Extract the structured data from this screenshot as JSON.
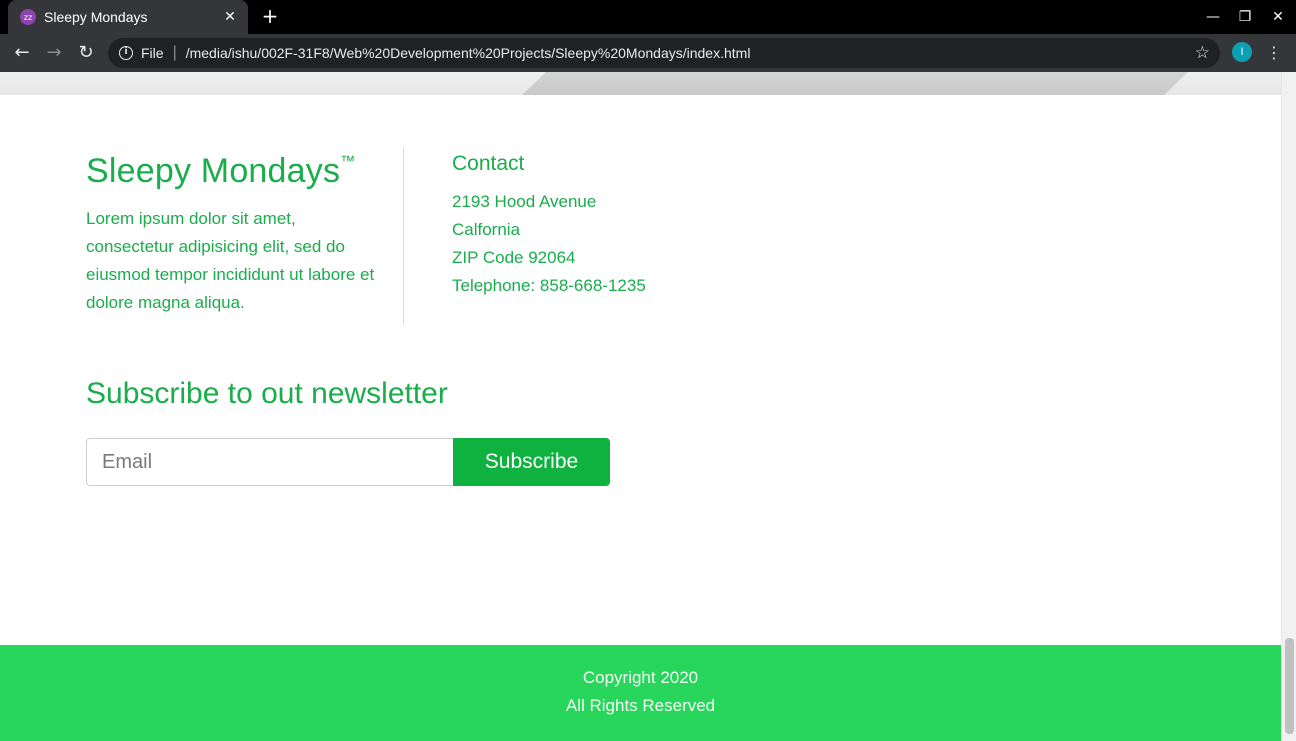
{
  "browser": {
    "tab": {
      "title": "Sleepy Mondays",
      "favicon": "zz",
      "close": "✕"
    },
    "new_tab": "+",
    "window_controls": {
      "minimize": "—",
      "maximize": "❐",
      "close": "✕"
    },
    "nav": {
      "back": "←",
      "forward": "→",
      "reload": "↻"
    },
    "address_bar": {
      "info_icon": "i",
      "scheme": "File",
      "separator": "|",
      "url": "/media/ishu/002F-31F8/Web%20Development%20Projects/Sleepy%20Mondays/index.html",
      "bookmark_icon": "☆"
    },
    "profile_initial": "I",
    "menu_icon": "⋮"
  },
  "footer_brand": {
    "title": "Sleepy Mondays",
    "trademark": "™",
    "description": "Lorem ipsum dolor sit amet, consectetur adipisicing elit, sed do eiusmod tempor incididunt ut labore et dolore magna aliqua."
  },
  "contact": {
    "title": "Contact",
    "lines": [
      "2193 Hood Avenue",
      "Calfornia",
      "ZIP Code 92064",
      "Telephone: 858-668-1235"
    ]
  },
  "newsletter": {
    "title": "Subscribe to out newsletter",
    "email_placeholder": "Email",
    "email_value": "",
    "button_label": "Subscribe"
  },
  "copyright": {
    "line1": "Copyright 2020",
    "line2": "All Rights Reserved"
  },
  "colors": {
    "brand_green": "#1aad4c",
    "button_green": "#0fb13f",
    "footer_green": "#27d65a"
  }
}
